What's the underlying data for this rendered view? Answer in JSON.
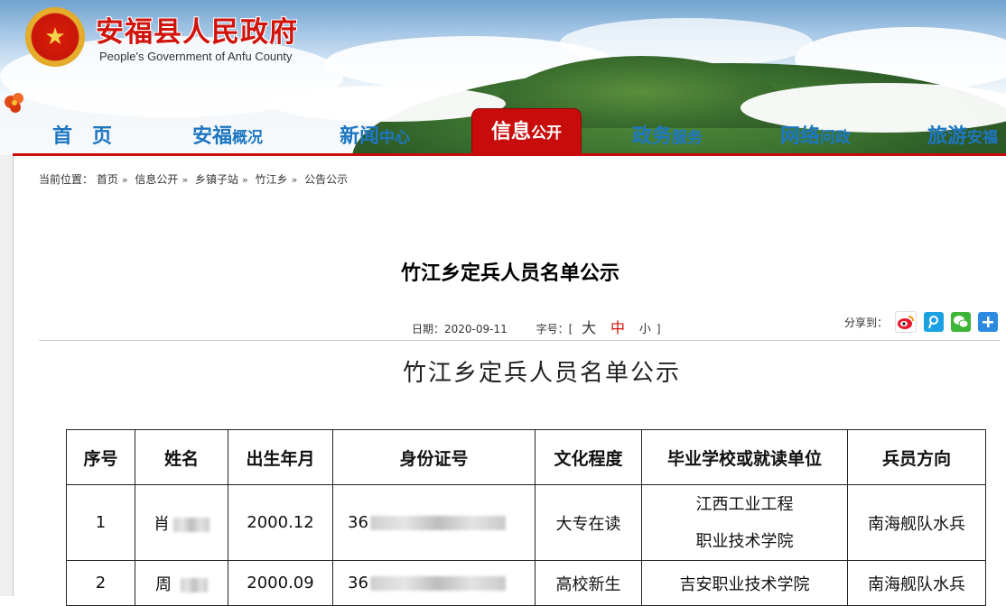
{
  "header": {
    "title": "安福县人民政府",
    "subtitle": "People's Government of Anfu County"
  },
  "nav": {
    "items": [
      {
        "main": "首　页",
        "sub": ""
      },
      {
        "main": "安福",
        "sub": "概况"
      },
      {
        "main": "新闻",
        "sub": "中心"
      },
      {
        "main": "信息",
        "sub": "公开"
      },
      {
        "main": "政务",
        "sub": "服务"
      },
      {
        "main": "网络",
        "sub": "问政"
      },
      {
        "main": "旅游",
        "sub": "安福"
      }
    ],
    "active_index": 3
  },
  "breadcrumb": {
    "label": "当前位置：",
    "items": [
      "首页",
      "信息公开",
      "乡镇子站",
      "竹江乡",
      "公告公示"
    ],
    "separator": "»"
  },
  "article": {
    "title": "竹江乡定兵人员名单公示",
    "date_label": "日期：",
    "date": "2020-09-11",
    "font_label": "字号：",
    "font_open": "[",
    "font_close": "]",
    "font_large": "大",
    "font_medium": "中",
    "font_small": "小",
    "share_label": "分享到："
  },
  "document": {
    "title": "竹江乡定兵人员名单公示",
    "table": {
      "headers": [
        "序号",
        "姓名",
        "出生年月",
        "身份证号",
        "文化程度",
        "毕业学校或就读单位",
        "兵员方向"
      ],
      "rows": [
        {
          "no": "1",
          "name": "肖",
          "birth": "2000.12",
          "id": "36",
          "edu": "大专在读",
          "school_line1": "江西工业工程",
          "school_line2": "职业技术学院",
          "direction": "南海舰队水兵"
        },
        {
          "no": "2",
          "name": "周",
          "birth": "2000.09",
          "id": "36",
          "edu": "高校新生",
          "school_line1": "吉安职业技术学院",
          "school_line2": "",
          "direction": "南海舰队水兵"
        }
      ]
    }
  },
  "colors": {
    "brand_red": "#c80c0c",
    "nav_blue": "#1d76c2"
  },
  "icons": {
    "share": [
      "weibo-icon",
      "tencent-weibo-icon",
      "wechat-icon",
      "more-share-icon"
    ]
  }
}
